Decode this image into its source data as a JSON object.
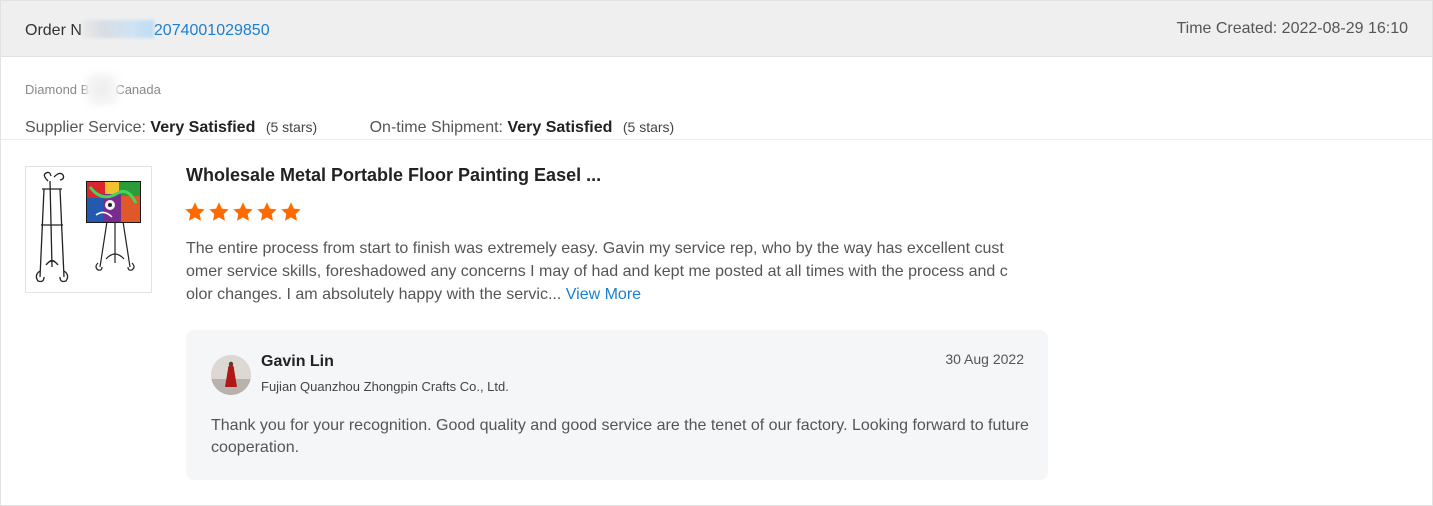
{
  "order": {
    "label": "Order N",
    "number_visible": "2074001029850",
    "time_created": "Time Created: 2022-08-29 16:10"
  },
  "buyer": {
    "name_start": "Diamond B",
    "country": "Canada"
  },
  "ratings": [
    {
      "label": "Supplier Service:",
      "value": "Very Satisfied",
      "stars": "(5 stars)"
    },
    {
      "label": "On-time Shipment:",
      "value": "Very Satisfied",
      "stars": "(5 stars)"
    }
  ],
  "product": {
    "title": "Wholesale Metal Portable Floor Painting Easel ...",
    "rating": 5,
    "star_color": "#ff6a00",
    "review": "The entire process from start to finish was extremely easy. Gavin my service rep, who by the way has excellent customer service skills, foreshadowed any concerns I may of had and kept me posted at all times with the process and color changes. I am absolutely happy with the servic...",
    "view_more": "View More"
  },
  "reply": {
    "name": "Gavin Lin",
    "company": "Fujian Quanzhou Zhongpin Crafts Co., Ltd.",
    "date": "30 Aug 2022",
    "text": "Thank you for your recognition. Good quality and good service are the tenet of our factory. Looking forward to future cooperation."
  },
  "colors": {
    "link": "#1b7fd0",
    "header_bg": "#efefef",
    "reply_bg": "#f5f6f8"
  }
}
